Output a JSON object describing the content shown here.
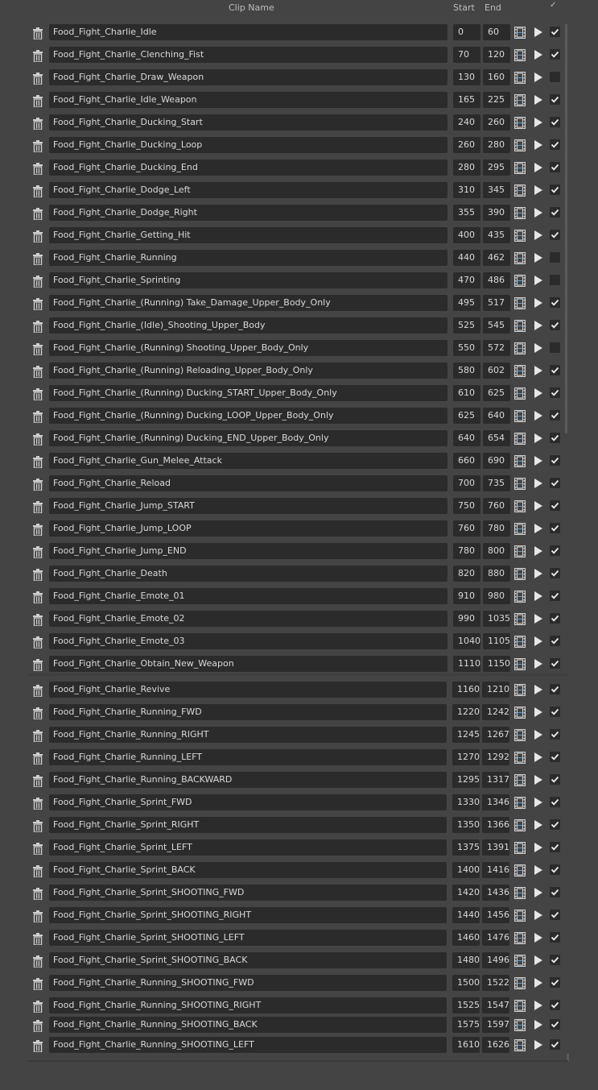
{
  "header": {
    "clip_name": "Clip Name",
    "start": "Start",
    "end": "End",
    "check_header": "✓"
  },
  "colors": {
    "background": "#444444",
    "field": "#2b2b2b",
    "text": "#d9d9d9",
    "icon": "#e6e6e6"
  },
  "icons": {
    "delete": "trash-icon",
    "range": "film-icon",
    "play": "play-icon",
    "enabled": "checkbox"
  },
  "clips": [
    {
      "name": "Food_Fight_Charlie_Idle",
      "start": "0",
      "end": "60",
      "checked": true
    },
    {
      "name": "Food_Fight_Charlie_Clenching_Fist",
      "start": "70",
      "end": "120",
      "checked": true
    },
    {
      "name": "Food_Fight_Charlie_Draw_Weapon",
      "start": "130",
      "end": "160",
      "checked": false
    },
    {
      "name": "Food_Fight_Charlie_Idle_Weapon",
      "start": "165",
      "end": "225",
      "checked": true
    },
    {
      "name": "Food_Fight_Charlie_Ducking_Start",
      "start": "240",
      "end": "260",
      "checked": true
    },
    {
      "name": "Food_Fight_Charlie_Ducking_Loop",
      "start": "260",
      "end": "280",
      "checked": true
    },
    {
      "name": "Food_Fight_Charlie_Ducking_End",
      "start": "280",
      "end": "295",
      "checked": true
    },
    {
      "name": "Food_Fight_Charlie_Dodge_Left",
      "start": "310",
      "end": "345",
      "checked": true
    },
    {
      "name": "Food_Fight_Charlie_Dodge_Right",
      "start": "355",
      "end": "390",
      "checked": true
    },
    {
      "name": "Food_Fight_Charlie_Getting_Hit",
      "start": "400",
      "end": "435",
      "checked": true
    },
    {
      "name": "Food_Fight_Charlie_Running",
      "start": "440",
      "end": "462",
      "checked": false
    },
    {
      "name": "Food_Fight_Charlie_Sprinting",
      "start": "470",
      "end": "486",
      "checked": false
    },
    {
      "name": "Food_Fight_Charlie_(Running) Take_Damage_Upper_Body_Only",
      "start": "495",
      "end": "517",
      "checked": true
    },
    {
      "name": "Food_Fight_Charlie_(Idle)_Shooting_Upper_Body",
      "start": "525",
      "end": "545",
      "checked": true
    },
    {
      "name": "Food_Fight_Charlie_(Running) Shooting_Upper_Body_Only",
      "start": "550",
      "end": "572",
      "checked": false
    },
    {
      "name": "Food_Fight_Charlie_(Running) Reloading_Upper_Body_Only",
      "start": "580",
      "end": "602",
      "checked": true
    },
    {
      "name": "Food_Fight_Charlie_(Running) Ducking_START_Upper_Body_Only",
      "start": "610",
      "end": "625",
      "checked": true
    },
    {
      "name": "Food_Fight_Charlie_(Running) Ducking_LOOP_Upper_Body_Only",
      "start": "625",
      "end": "640",
      "checked": true
    },
    {
      "name": "Food_Fight_Charlie_(Running) Ducking_END_Upper_Body_Only",
      "start": "640",
      "end": "654",
      "checked": true
    },
    {
      "name": "Food_Fight_Charlie_Gun_Melee_Attack",
      "start": "660",
      "end": "690",
      "checked": true
    },
    {
      "name": "Food_Fight_Charlie_Reload",
      "start": "700",
      "end": "735",
      "checked": true
    },
    {
      "name": "Food_Fight_Charlie_Jump_START",
      "start": "750",
      "end": "760",
      "checked": true
    },
    {
      "name": "Food_Fight_Charlie_Jump_LOOP",
      "start": "760",
      "end": "780",
      "checked": true
    },
    {
      "name": "Food_Fight_Charlie_Jump_END",
      "start": "780",
      "end": "800",
      "checked": true
    },
    {
      "name": "Food_Fight_Charlie_Death",
      "start": "820",
      "end": "880",
      "checked": true
    },
    {
      "name": "Food_Fight_Charlie_Emote_01",
      "start": "910",
      "end": "980",
      "checked": true
    },
    {
      "name": "Food_Fight_Charlie_Emote_02",
      "start": "990",
      "end": "1035",
      "checked": true
    },
    {
      "name": "Food_Fight_Charlie_Emote_03",
      "start": "1040",
      "end": "1105",
      "checked": true
    },
    {
      "name": "Food_Fight_Charlie_Obtain_New_Weapon",
      "start": "1110",
      "end": "1150",
      "checked": true
    },
    {
      "name": "Food_Fight_Charlie_Revive",
      "start": "1160",
      "end": "1210",
      "checked": true
    },
    {
      "name": "Food_Fight_Charlie_Running_FWD",
      "start": "1220",
      "end": "1242",
      "checked": true
    },
    {
      "name": "Food_Fight_Charlie_Running_RIGHT",
      "start": "1245",
      "end": "1267",
      "checked": true
    },
    {
      "name": "Food_Fight_Charlie_Running_LEFT",
      "start": "1270",
      "end": "1292",
      "checked": true
    },
    {
      "name": "Food_Fight_Charlie_Running_BACKWARD",
      "start": "1295",
      "end": "1317",
      "checked": true
    },
    {
      "name": "Food_Fight_Charlie_Sprint_FWD",
      "start": "1330",
      "end": "1346",
      "checked": true
    },
    {
      "name": "Food_Fight_Charlie_Sprint_RIGHT",
      "start": "1350",
      "end": "1366",
      "checked": true
    },
    {
      "name": "Food_Fight_Charlie_Sprint_LEFT",
      "start": "1375",
      "end": "1391",
      "checked": true
    },
    {
      "name": "Food_Fight_Charlie_Sprint_BACK",
      "start": "1400",
      "end": "1416",
      "checked": true
    },
    {
      "name": "Food_Fight_Charlie_Sprint_SHOOTING_FWD",
      "start": "1420",
      "end": "1436",
      "checked": true
    },
    {
      "name": "Food_Fight_Charlie_Sprint_SHOOTING_RIGHT",
      "start": "1440",
      "end": "1456",
      "checked": true
    },
    {
      "name": "Food_Fight_Charlie_Sprint_SHOOTING_LEFT",
      "start": "1460",
      "end": "1476",
      "checked": true
    },
    {
      "name": "Food_Fight_Charlie_Sprint_SHOOTING_BACK",
      "start": "1480",
      "end": "1496",
      "checked": true
    },
    {
      "name": "Food_Fight_Charlie_Running_SHOOTING_FWD",
      "start": "1500",
      "end": "1522",
      "checked": true
    },
    {
      "name": "Food_Fight_Charlie_Running_SHOOTING_RIGHT",
      "start": "1525",
      "end": "1547",
      "checked": true
    },
    {
      "name": "Food_Fight_Charlie_Running_SHOOTING_BACK",
      "start": "1575",
      "end": "1597",
      "checked": true
    },
    {
      "name": "Food_Fight_Charlie_Running_SHOOTING_LEFT",
      "start": "1610",
      "end": "1626",
      "checked": true
    }
  ]
}
